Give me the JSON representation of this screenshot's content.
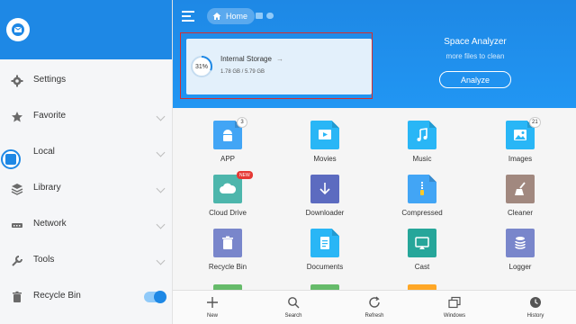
{
  "sidebar": {
    "items": [
      {
        "label": "Settings",
        "icon": "gear-icon"
      },
      {
        "label": "Favorite",
        "icon": "star-icon"
      },
      {
        "label": "Local",
        "icon": "phone-icon"
      },
      {
        "label": "Library",
        "icon": "layers-icon"
      },
      {
        "label": "Network",
        "icon": "network-icon"
      },
      {
        "label": "Tools",
        "icon": "wrench-icon"
      },
      {
        "label": "Recycle Bin",
        "icon": "trash-icon",
        "toggle_on": true
      }
    ]
  },
  "header": {
    "home_label": "Home"
  },
  "storage": {
    "percent_label": "31%",
    "percent_value": 0.31,
    "title": "Internal Storage",
    "size": "1.78 GB / 5.79 GB"
  },
  "analyzer": {
    "title": "Space Analyzer",
    "subtitle": "more files to clean",
    "button": "Analyze"
  },
  "grid": {
    "items": [
      {
        "label": "APP",
        "badge": "3",
        "color": "#42a5f5",
        "icon": "android-icon"
      },
      {
        "label": "Movies",
        "color": "#29b6f6",
        "icon": "play-icon"
      },
      {
        "label": "Music",
        "color": "#29b6f6",
        "icon": "music-note-icon"
      },
      {
        "label": "Images",
        "badge": "21",
        "color": "#29b6f6",
        "icon": "image-icon"
      },
      {
        "label": "Cloud Drive",
        "badge_new": "NEW",
        "color": "#4db6ac",
        "icon": "cloud-icon"
      },
      {
        "label": "Downloader",
        "color": "#5c6bc0",
        "icon": "download-icon"
      },
      {
        "label": "Compressed",
        "color": "#42a5f5",
        "icon": "zip-icon"
      },
      {
        "label": "Cleaner",
        "color": "#a1887f",
        "icon": "broom-icon"
      },
      {
        "label": "Recycle Bin",
        "color": "#7986cb",
        "icon": "trash-icon"
      },
      {
        "label": "Documents",
        "color": "#29b6f6",
        "icon": "document-icon"
      },
      {
        "label": "Cast",
        "color": "#26a69a",
        "icon": "cast-icon"
      },
      {
        "label": "Logger",
        "color": "#7986cb",
        "icon": "stack-icon"
      }
    ]
  },
  "bottom_nav": {
    "items": [
      {
        "label": "New",
        "icon": "plus-icon"
      },
      {
        "label": "Search",
        "icon": "search-icon"
      },
      {
        "label": "Refresh",
        "icon": "refresh-icon"
      },
      {
        "label": "Windows",
        "icon": "windows-icon"
      },
      {
        "label": "History",
        "icon": "clock-icon"
      }
    ]
  }
}
